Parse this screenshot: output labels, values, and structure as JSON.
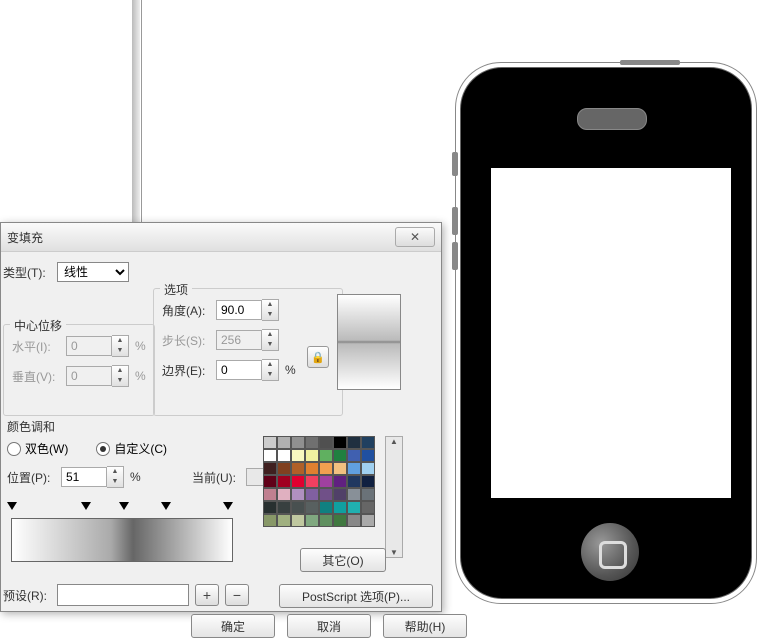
{
  "dialog": {
    "title": "变填充",
    "type_label": "类型(T):",
    "type_value": "线性",
    "center_group": "中心位移",
    "horiz_label": "水平(I):",
    "horiz_value": "0",
    "vert_label": "垂直(V):",
    "vert_value": "0",
    "percent": "%",
    "options_group": "选项",
    "angle_label": "角度(A):",
    "angle_value": "90.0",
    "steps_label": "步长(S):",
    "steps_value": "256",
    "edge_label": "边界(E):",
    "edge_value": "0",
    "blend_label": "颜色调和",
    "radio_two": "双色(W)",
    "radio_custom": "自定义(C)",
    "position_label": "位置(P):",
    "position_value": "51",
    "current_label": "当前(U):",
    "other_btn": "其它(O)",
    "preset_label": "预设(R):",
    "add": "+",
    "remove": "−",
    "postscript_btn": "PostScript 选项(P)...",
    "ok": "确定",
    "cancel": "取消",
    "help": "帮助(H)"
  },
  "palette": [
    "#cccccc",
    "#b0b0b0",
    "#909090",
    "#707070",
    "#505050",
    "#000000",
    "#203040",
    "#204060",
    "#ffffff",
    "#ffffff",
    "#f8f8c0",
    "#f0f0a0",
    "#60b060",
    "#208040",
    "#4060b0",
    "#2050a0",
    "#402020",
    "#804020",
    "#b06028",
    "#e08030",
    "#f0a050",
    "#f0c080",
    "#60a0e0",
    "#a0d0f0",
    "#600018",
    "#a00020",
    "#e00030",
    "#f04060",
    "#a040a0",
    "#602080",
    "#203860",
    "#102040",
    "#c08090",
    "#e0b0c0",
    "#b090c0",
    "#8060a0",
    "#705088",
    "#504068",
    "#889098",
    "#6a7278",
    "#283030",
    "#384040",
    "#485050",
    "#586060",
    "#108080",
    "#10a0a0",
    "#20b0b0",
    "#666666",
    "#889868",
    "#a0b080",
    "#c0c8a0",
    "#80a880",
    "#609060",
    "#407840",
    "#888888",
    "#aaaaaa"
  ]
}
